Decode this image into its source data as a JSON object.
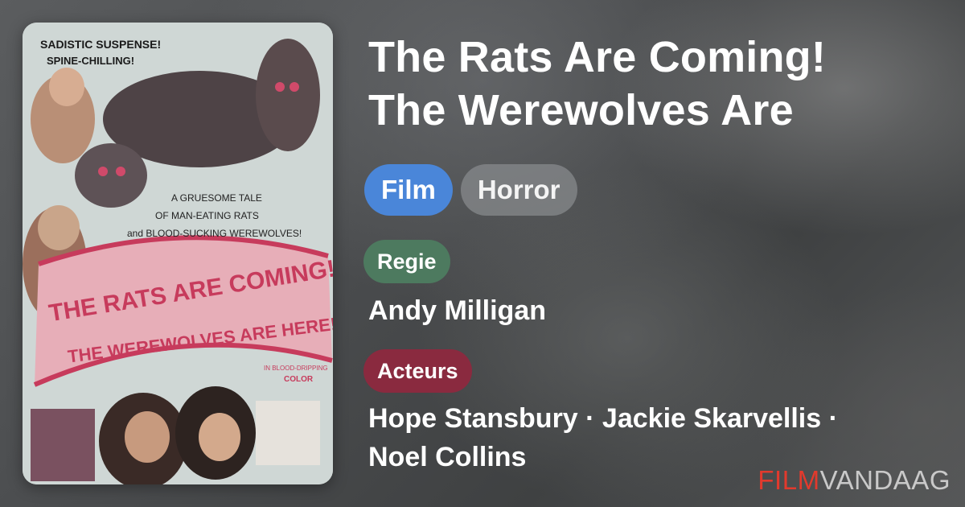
{
  "movie": {
    "title_line1": "The Rats Are Coming!",
    "title_line2": "The Werewolves Are",
    "tags": [
      "Film",
      "Horror"
    ],
    "director_label": "Regie",
    "director": "Andy Milligan",
    "cast_label": "Acteurs",
    "cast_line1": "Hope Stansbury · Jackie Skarvellis ·",
    "cast_line2": "Noel Collins"
  },
  "poster": {
    "tagline1": "SADISTIC SUSPENSE!",
    "tagline2": "SPINE-CHILLING!",
    "blurb1": "A GRUESOME TALE",
    "blurb2": "OF MAN-EATING RATS",
    "blurb3": "and BLOOD-SUCKING WEREWOLVES!",
    "title1": "THE RATS ARE COMING!",
    "title2": "THE WEREWOLVES ARE HERE!",
    "color_note1": "IN BLOOD-DRIPPING",
    "color_note2": "COLOR"
  },
  "logo": {
    "part1": "FILM",
    "part2": "VANDAAG",
    "accent": "#e23a2d"
  }
}
